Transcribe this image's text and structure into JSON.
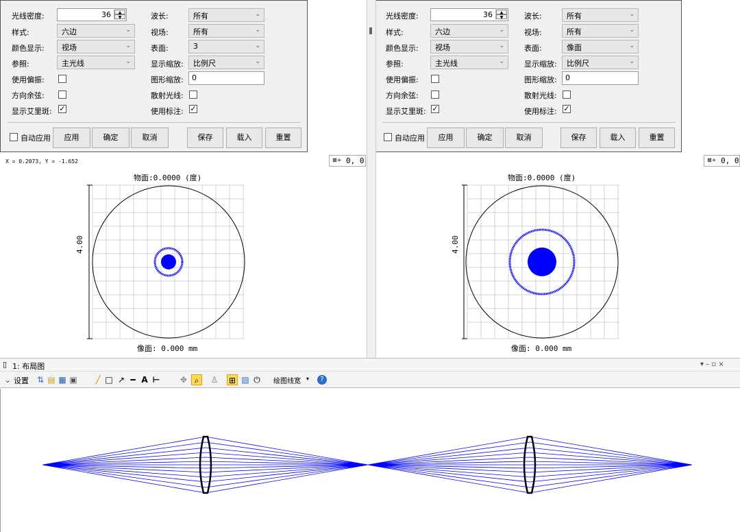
{
  "left_settings": {
    "ray_density_label": "光线密度:",
    "ray_density_value": "36",
    "style_label": "样式:",
    "style_value": "六边",
    "color_label": "颜色显示:",
    "color_value": "视场",
    "ref_label": "参照:",
    "ref_value": "主光线",
    "polarization_label": "使用偏振:",
    "direction_cosine_label": "方向余弦:",
    "airy_label": "显示艾里斑:",
    "wavelength_label": "波长:",
    "wavelength_value": "所有",
    "field_label": "视场:",
    "field_value": "所有",
    "surface_label": "表面:",
    "surface_value": "3",
    "scale_label": "显示缩放:",
    "scale_value": "比例尺",
    "plot_scale_label": "图形缩放:",
    "plot_scale_value": "0",
    "scatter_label": "散射光线:",
    "annotation_label": "使用标注:",
    "auto_apply_label": "自动应用",
    "apply_label": "应用",
    "ok_label": "确定",
    "cancel_label": "取消",
    "save_label": "保存",
    "load_label": "载入",
    "reset_label": "重置"
  },
  "right_settings": {
    "ray_density_label": "光线密度:",
    "ray_density_value": "36",
    "style_label": "样式:",
    "style_value": "六边",
    "color_label": "颜色显示:",
    "color_value": "视场",
    "ref_label": "参照:",
    "ref_value": "主光线",
    "polarization_label": "使用偏振:",
    "direction_cosine_label": "方向余弦:",
    "airy_label": "显示艾里斑:",
    "wavelength_label": "波长:",
    "wavelength_value": "所有",
    "field_label": "视场:",
    "field_value": "所有",
    "surface_label": "表面:",
    "surface_value": "像面",
    "scale_label": "显示缩放:",
    "scale_value": "比例尺",
    "plot_scale_label": "图形缩放:",
    "plot_scale_value": "0",
    "scatter_label": "散射光线:",
    "annotation_label": "使用标注:",
    "auto_apply_label": "自动应用",
    "apply_label": "应用",
    "ok_label": "确定",
    "cancel_label": "取消",
    "save_label": "保存",
    "load_label": "载入",
    "reset_label": "重置"
  },
  "left_plot": {
    "cursor_readout": "X = 0.2073, Y = -1.652",
    "corner_readout": "0, 0",
    "object_title": "物面:0.0000 (度)",
    "scale_label": "4.00",
    "image_label": "像面: 0.000 mm"
  },
  "right_plot": {
    "corner_readout": "0, 0",
    "object_title": "物面:0.0000 (度)",
    "scale_label": "4.00",
    "image_label": "像面: 0.000 mm"
  },
  "layout_window": {
    "title": "1: 布局图",
    "window_controls": "▾ – ▫ ×",
    "settings_label": "设置",
    "line_width_label": "绘图线宽"
  },
  "colors": {
    "ray_blue": "#0000ff",
    "panel_bg": "#f0f0f0",
    "toolbar_bg": "#f3f3f3"
  }
}
